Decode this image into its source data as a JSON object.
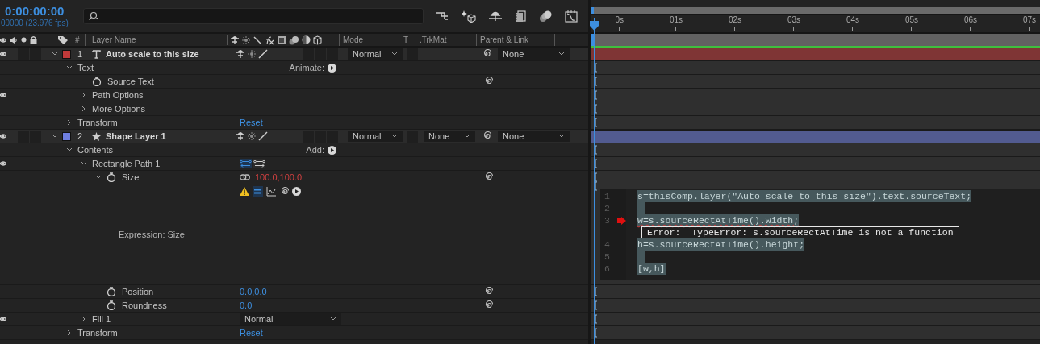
{
  "header": {
    "timecode": "0:00:00:00",
    "frame_info": "00000 (23.976 fps)"
  },
  "columns": {
    "number": "#",
    "layer_name": "Layer Name",
    "mode": "Mode",
    "track_matte_t": "T",
    "track_matte": ".TrkMat",
    "parent": "Parent & Link"
  },
  "ruler": {
    "ticks": [
      "0s",
      "01s",
      "02s",
      "03s",
      "04s",
      "05s",
      "06s",
      "07s"
    ]
  },
  "layers": [
    {
      "number": "1",
      "name": "Auto scale to this size",
      "kind": "text",
      "color": "#c03a3a",
      "expanded": true,
      "visible": true,
      "mode": "Normal",
      "parent": "None",
      "children": [
        {
          "kind": "group",
          "label": "Text",
          "expanded": true,
          "action": "Animate:",
          "children": [
            {
              "kind": "property",
              "label": "Source Text",
              "pickwhip": true
            },
            {
              "kind": "group",
              "label": "Path Options",
              "expanded": false,
              "visible": true
            },
            {
              "kind": "group",
              "label": "More Options",
              "expanded": false
            }
          ]
        },
        {
          "kind": "group",
          "label": "Transform",
          "expanded": false,
          "value": "Reset"
        }
      ]
    },
    {
      "number": "2",
      "name": "Shape Layer 1",
      "kind": "shape",
      "color": "#6f7fe0",
      "expanded": true,
      "visible": true,
      "mode": "Normal",
      "track_matte": "None",
      "parent": "None",
      "children": [
        {
          "kind": "group",
          "label": "Contents",
          "expanded": true,
          "action": "Add:",
          "children": [
            {
              "kind": "path",
              "label": "Rectangle Path 1",
              "expanded": true,
              "visible": true,
              "children": [
                {
                  "kind": "property",
                  "label": "Size",
                  "expanded": true,
                  "value": "100.0,100.0",
                  "linked": true,
                  "pickwhip": true,
                  "expression": {
                    "label": "Expression: Size",
                    "enabled": true,
                    "lines": [
                      {
                        "number": "1",
                        "code": "s=thisComp.layer(\"Auto scale to this size\").text.sourceText;"
                      },
                      {
                        "number": "2"
                      },
                      {
                        "number": "3",
                        "code": "w=s.sourceRectAtTime().width;",
                        "error": true
                      },
                      {
                        "number": "4",
                        "code": "h=s.sourceRectAtTime().height;"
                      },
                      {
                        "number": "5"
                      },
                      {
                        "number": "6",
                        "code": "[w,h]"
                      }
                    ],
                    "error_message": "Error:  TypeError: s.sourceRectAtTime is not a function"
                  }
                },
                {
                  "kind": "property",
                  "label": "Position",
                  "value": "0.0,0.0",
                  "pickwhip": true
                },
                {
                  "kind": "property",
                  "label": "Roundness",
                  "value": "0.0",
                  "pickwhip": true
                }
              ]
            },
            {
              "kind": "group",
              "label": "Fill 1",
              "expanded": false,
              "visible": true,
              "mode": "Normal"
            }
          ]
        },
        {
          "kind": "group",
          "label": "Transform",
          "expanded": false,
          "value": "Reset"
        }
      ]
    }
  ]
}
